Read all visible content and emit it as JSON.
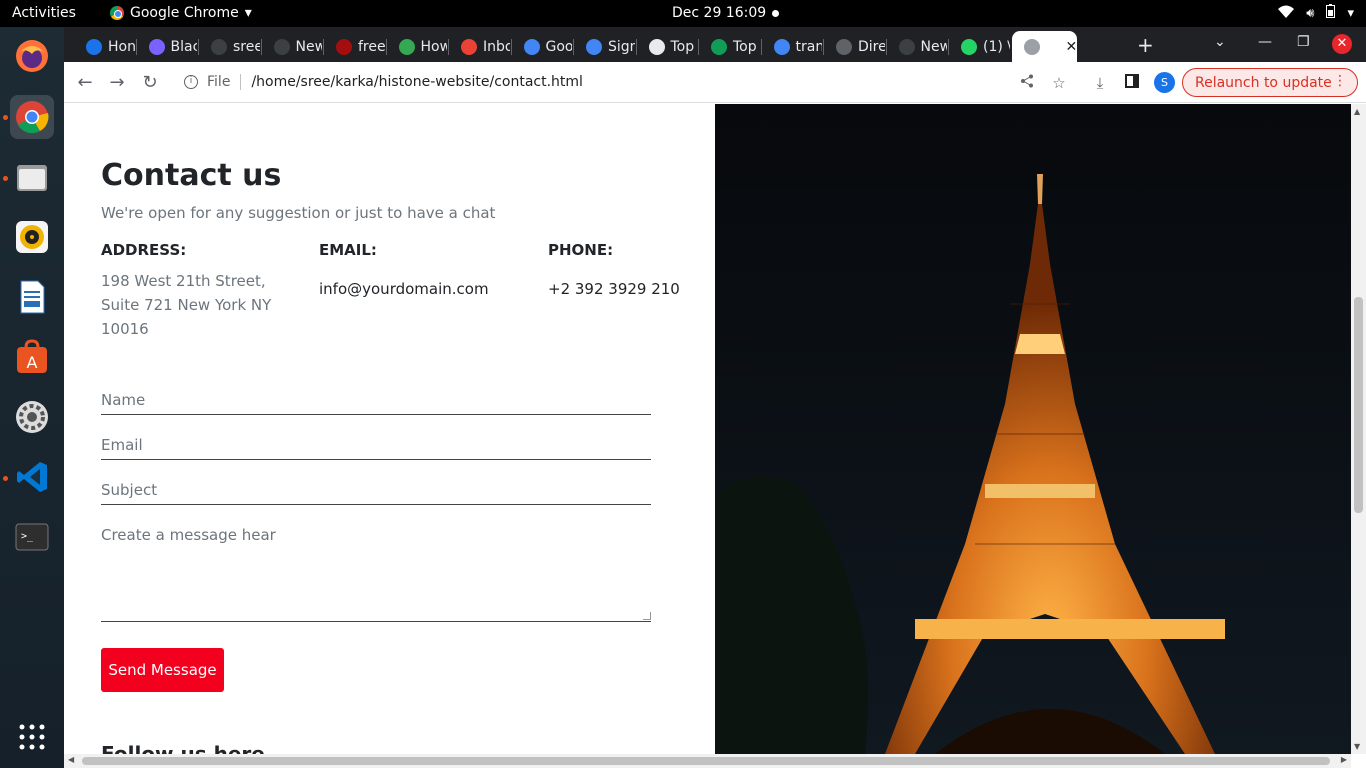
{
  "system": {
    "activities": "Activities",
    "app_menu": "Google Chrome",
    "clock": "Dec 29  16:09"
  },
  "dock": {
    "items": [
      "firefox-icon",
      "chrome-icon",
      "files-icon",
      "rhythmbox-icon",
      "writer-icon",
      "software-icon",
      "settings-icon",
      "vscode-icon",
      "terminal-icon",
      "app-grid-icon"
    ]
  },
  "browser": {
    "tabs": [
      {
        "label": "Hon",
        "favicon_color": "#1a73e8"
      },
      {
        "label": "Blac",
        "favicon_color": "#7b61ff"
      },
      {
        "label": "sree",
        "favicon_color": "#3c4043"
      },
      {
        "label": "New",
        "favicon_color": "#3c4043"
      },
      {
        "label": "free",
        "favicon_color": "#a50e0e"
      },
      {
        "label": "How",
        "favicon_color": "#34a853"
      },
      {
        "label": "Inbo",
        "favicon_color": "#ea4335"
      },
      {
        "label": "Goo",
        "favicon_color": "#4285f4"
      },
      {
        "label": "Sign",
        "favicon_color": "#4285f4"
      },
      {
        "label": "Top",
        "favicon_color": "#e8eaed"
      },
      {
        "label": "Top",
        "favicon_color": "#0f9d58"
      },
      {
        "label": "tran",
        "favicon_color": "#4285f4"
      },
      {
        "label": "Dire",
        "favicon_color": "#5f6368"
      },
      {
        "label": "New",
        "favicon_color": "#3c4043"
      },
      {
        "label": "(1) \\",
        "favicon_color": "#25d366"
      },
      {
        "label": "",
        "favicon_color": "#9aa0a6",
        "active": true
      }
    ],
    "address": {
      "scheme_label": "File",
      "url": "/home/sree/karka/histone-website/contact.html"
    },
    "profile_initial": "S",
    "relaunch_label": "Relaunch to update"
  },
  "page": {
    "title": "Contact us",
    "subtitle": "We're open for any suggestion or just to have a chat",
    "address_label": "ADDRESS:",
    "address_value": "198 West 21th Street, Suite 721 New York NY 10016",
    "email_label": "EMAIL:",
    "email_value": "info@yourdomain.com",
    "phone_label": "PHONE:",
    "phone_value": "+2 392 3929 210",
    "form": {
      "name_placeholder": "Name",
      "email_placeholder": "Email",
      "subject_placeholder": "Subject",
      "message_placeholder": "Create a message hear",
      "send_label": "Send Message"
    },
    "follow_heading": "Follow us here",
    "hero_image": "eiffel-tower-night-photo"
  }
}
